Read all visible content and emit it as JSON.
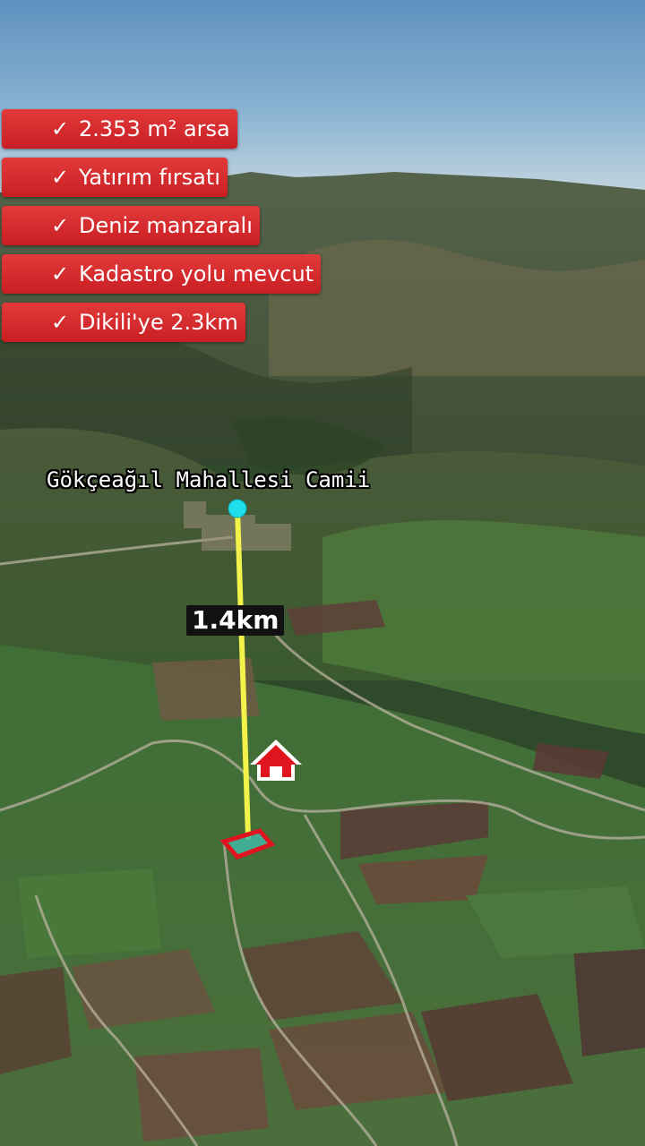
{
  "badges": [
    {
      "check": "✓",
      "text": "2.353 m² arsa"
    },
    {
      "check": "✓",
      "text": "Yatırım fırsatı"
    },
    {
      "check": "✓",
      "text": "Deniz manzaralı"
    },
    {
      "check": "✓",
      "text": "Kadastro yolu mevcut"
    },
    {
      "check": "✓",
      "text": "Dikili'ye 2.3km"
    }
  ],
  "map": {
    "place_label": "Gökçeağıl Mahallesi Camii",
    "distance_label": "1.4km",
    "line_color": "#f2f24a",
    "point_color": "#1ee0ec",
    "parcel_color": "#e0141c",
    "home_icon": "house-icon"
  }
}
